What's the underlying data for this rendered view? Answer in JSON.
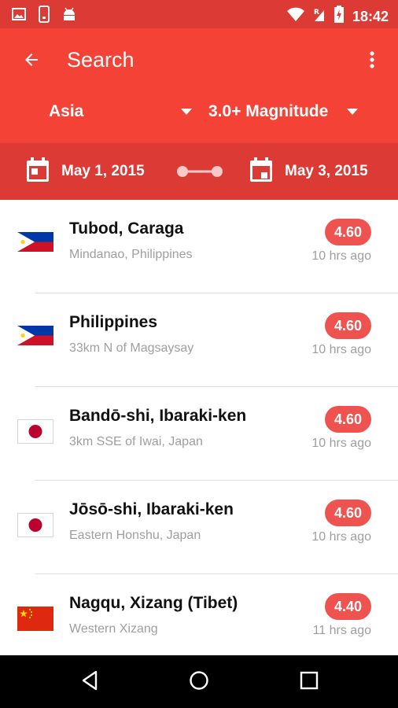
{
  "status_bar": {
    "time": "18:42",
    "left_icons": [
      "image-icon",
      "phone-alert-icon",
      "android-icon"
    ],
    "right_icons": [
      "wifi-icon",
      "signal-roaming-icon",
      "battery-charging-icon"
    ]
  },
  "app_bar": {
    "title": "Search",
    "back_icon": "arrow-back-icon",
    "overflow_icon": "more-vert-icon",
    "region_filter": "Asia",
    "magnitude_filter": "3.0+ Magnitude"
  },
  "date_range": {
    "start": "May 1, 2015",
    "end": "May 3, 2015"
  },
  "earthquakes": [
    {
      "flag": "philippines-flag",
      "place": "Tubod, Caraga",
      "region": "Mindanao, Philippines",
      "magnitude": "4.60",
      "time_ago": "10 hrs ago"
    },
    {
      "flag": "philippines-flag",
      "place": "Philippines",
      "region": "33km N of Magsaysay",
      "magnitude": "4.60",
      "time_ago": "10 hrs ago"
    },
    {
      "flag": "japan-flag",
      "place": "Bandō-shi, Ibaraki-ken",
      "region": "3km SSE of Iwai, Japan",
      "magnitude": "4.60",
      "time_ago": "10 hrs ago"
    },
    {
      "flag": "japan-flag",
      "place": "Jōsō-shi, Ibaraki-ken",
      "region": "Eastern Honshu, Japan",
      "magnitude": "4.60",
      "time_ago": "10 hrs ago"
    },
    {
      "flag": "china-flag",
      "place": "Nagqu, Xizang (Tibet)",
      "region": "Western Xizang",
      "magnitude": "4.40",
      "time_ago": "11 hrs ago"
    }
  ],
  "colors": {
    "primary": "#f44336",
    "primary_dark": "#dc3a34",
    "badge": "#ef5350"
  }
}
